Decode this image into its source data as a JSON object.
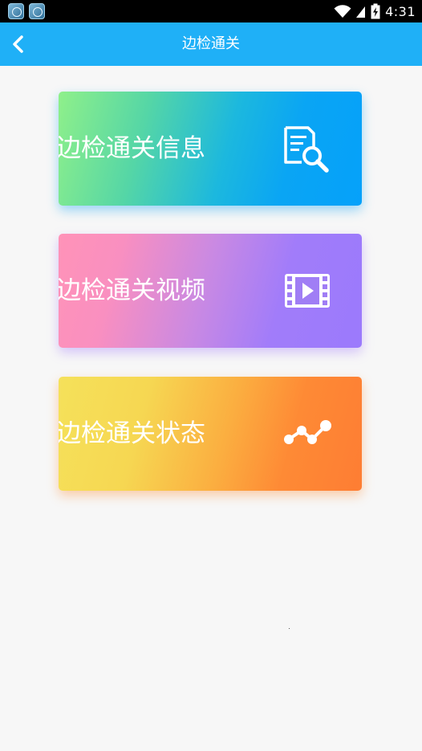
{
  "status_bar": {
    "time": "4:31",
    "app_icons": [
      "app-icon",
      "app-icon"
    ],
    "icons": [
      "wifi-icon",
      "signal-icon",
      "battery-charging-icon"
    ]
  },
  "nav": {
    "title": "边检通关",
    "back_icon": "chevron-left-icon",
    "background": "#1fb0f7"
  },
  "cards": [
    {
      "label": "边检通关信息",
      "icon": "document-search-icon",
      "gradient": [
        "#8ff08a",
        "#05a1fa"
      ]
    },
    {
      "label": "边检通关视频",
      "icon": "video-film-icon",
      "gradient": [
        "#ff93b8",
        "#9b7afc"
      ]
    },
    {
      "label": "边检通关状态",
      "icon": "line-chart-icon",
      "gradient": [
        "#f5e15a",
        "#fe7d33"
      ]
    }
  ]
}
